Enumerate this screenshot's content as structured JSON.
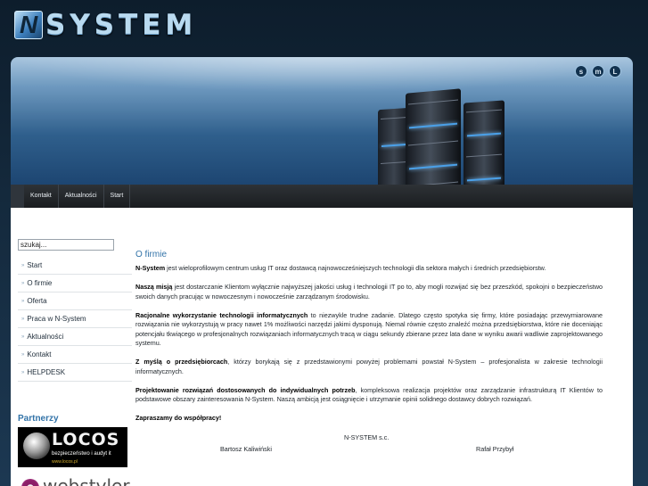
{
  "header": {
    "logo_text": "SYSTEM",
    "logo_mark": "N",
    "size_buttons": [
      "s",
      "m",
      "L"
    ]
  },
  "nav": {
    "items": [
      "Kontakt",
      "Aktualności",
      "Start"
    ]
  },
  "sidebar": {
    "search_value": "szukaj...",
    "menu": [
      "Start",
      "O firmie",
      "Oferta",
      "Praca w N-System",
      "Aktualności",
      "Kontakt",
      "HELPDESK"
    ],
    "menu_bullet": "»",
    "partners_title": "Partnerzy",
    "partner1": {
      "name": "LOCOS",
      "tagline": "bezpieczeństwo i audyt it",
      "url": "www.locos.pl"
    },
    "partner2": {
      "name": "webstyler"
    }
  },
  "main": {
    "title": "O firmie",
    "p1": {
      "bold": "N-System",
      "text": " jest wieloprofilowym centrum usług IT oraz dostawcą najnowocześniejszych technologii dla sektora małych i średnich przedsiębiorstw."
    },
    "p2": {
      "bold": "Naszą misją",
      "text": " jest dostarczanie Klientom wyłącznie najwyższej jakości usług i technologii IT po to, aby mogli rozwijać się bez przeszkód, spokojni o bezpieczeństwo swoich danych pracując w nowoczesnym i nowocześnie zarządzanym środowisku."
    },
    "p3": {
      "bold": "Racjonalne wykorzystanie technologii informatycznych",
      "text": " to niezwykle trudne zadanie. Dlatego często spotyka się firmy, które posiadając przewymiarowane rozwiązania nie wykorzystują w pracy nawet 1% możliwości narzędzi jakimi dysponują. Niemal równie często znaleźć można przedsiębiorstwa, które nie doceniając potencjału tkwiącego w profesjonalnych rozwiązaniach informatycznych tracą w ciągu sekundy zbierane przez lata dane w wyniku awarii wadliwie zaprojektowanego systemu."
    },
    "p4": {
      "bold": "Z myślą o przedsiębiorcach",
      "text": ", którzy borykają się z przedstawionymi powyżej problemami powstał N-System – profesjonalista w zakresie technologii informatycznych."
    },
    "p5": {
      "bold": "Projektowanie rozwiązań dostosowanych do indywidualnych potrzeb",
      "text": ", kompleksowa realizacja projektów oraz zarządzanie infrastrukturą IT Klientów to podstawowe obszary zainteresowania N-System. Naszą ambicją jest osiągnięcie i utrzymanie opinii solidnego dostawcy dobrych rozwiązań."
    },
    "p6": {
      "bold": "Zapraszamy do współpracy!"
    },
    "company": "N-SYSTEM s.c.",
    "person1": "Bartosz Kaliwiński",
    "person2": "Rafał Przybył"
  }
}
